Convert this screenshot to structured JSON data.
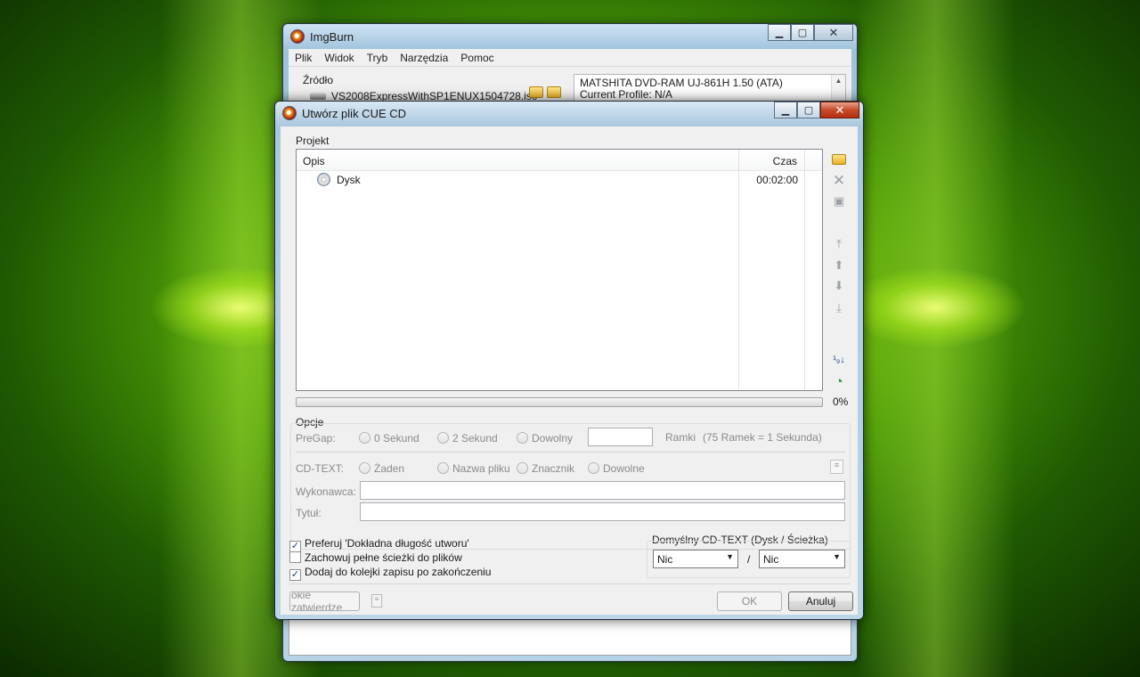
{
  "main_window": {
    "title": "ImgBurn",
    "menu": [
      "Plik",
      "Widok",
      "Tryb",
      "Narzędzia",
      "Pomoc"
    ],
    "source_label": "Źródło",
    "source_file": "VS2008ExpressWithSP1ENUX1504728.iso",
    "device_line1": "MATSHITA DVD-RAM UJ-861H 1.50 (ATA)",
    "device_line2": "Current Profile: N/A"
  },
  "dialog": {
    "title": "Utwórz plik CUE CD",
    "project_label": "Projekt",
    "columns": {
      "desc": "Opis",
      "time": "Czas"
    },
    "rows": [
      {
        "name": "Dysk",
        "time": "00:02:00",
        "icon": "disc-icon"
      }
    ],
    "progress_text": "0%",
    "progress_value": 0,
    "options_label": "Opcje",
    "pregap": {
      "label": "PreGap:",
      "opt0": "0 Sekund",
      "opt2": "2 Sekund",
      "custom": "Dowolny",
      "frames_label": "Ramki",
      "frames_hint": "(75 Ramek = 1 Sekunda)",
      "frames_value": ""
    },
    "cdtext": {
      "label": "CD-TEXT:",
      "none": "Żaden",
      "filename": "Nazwa pliku",
      "tag": "Znacznik",
      "custom": "Dowolne"
    },
    "performer": {
      "label": "Wykonawca:",
      "value": ""
    },
    "title_field": {
      "label": "Tytuł:",
      "value": ""
    },
    "checks": {
      "exact_length": "Preferuj 'Dokładna długość utworu'",
      "full_paths": "Zachowuj pełne ścieżki do plików",
      "add_to_queue": "Dodaj do kolejki zapisu po zakończeniu"
    },
    "default_cdtext": {
      "label": "Domyślny CD-TEXT (Dysk / Ścieżka)",
      "disc_value": "Nic",
      "separator": "/",
      "track_value": "Nic"
    },
    "buttons": {
      "confirm_cut": "okie zatwierdze",
      "ok": "OK",
      "cancel": "Anuluj"
    }
  },
  "colors": {
    "accent_green": "#8fcf12",
    "close_red": "#c74b2a"
  }
}
